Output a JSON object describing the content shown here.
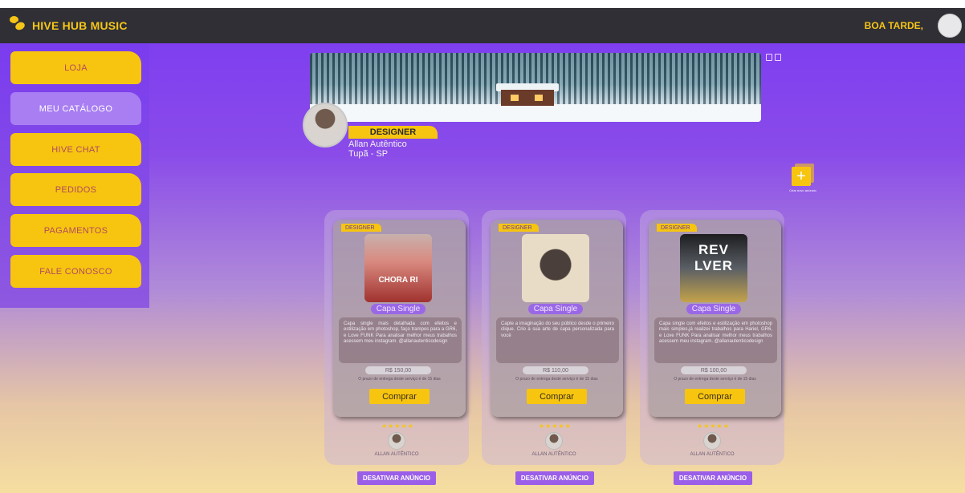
{
  "app": {
    "brand": "HIVE HUB MUSIC",
    "greeting": "BOA TARDE,"
  },
  "sidebar": {
    "items": [
      {
        "label": "LOJA",
        "active": false
      },
      {
        "label": "MEU CATÁLOGO",
        "active": true
      },
      {
        "label": "HIVE CHAT",
        "active": false
      },
      {
        "label": "PEDIDOS",
        "active": false
      },
      {
        "label": "PAGAMENTOS",
        "active": false
      },
      {
        "label": "FALE CONOSCO",
        "active": false
      }
    ]
  },
  "profile": {
    "role": "DESIGNER",
    "name": "Allan Autêntico",
    "location": "Tupã - SP"
  },
  "create": {
    "label": "Criar novo anúncio"
  },
  "cards": [
    {
      "tag": "DESIGNER",
      "cover_text": "CHORA RI",
      "service": "Capa Single",
      "description": "Capa single mais detalhada com efeitos e estilização em photoshop, faço trampos para a GR6, e Love FUNK Para analisar melhor meus trabalhos acessem meu instagram. @allanautenticodesign",
      "price": "R$ 150,00",
      "delivery": "O prazo de entrega deste serviço é de 15 dias",
      "buy_label": "Comprar",
      "stars": "★★★★★",
      "owner": "ALLAN AUTÊNTICO",
      "deactivate_label": "DESATIVAR ANÚNCIO"
    },
    {
      "tag": "DESIGNER",
      "cover_text": "",
      "service": "Capa Single",
      "description": "Capte a imaginação do seu público desde o primeiro clique. Crio a sua arte de capa personalizada para você",
      "price": "R$ 110,00",
      "delivery": "O prazo de entrega deste serviço é de 15 dias",
      "buy_label": "Comprar",
      "stars": "★★★★★",
      "owner": "ALLAN AUTÊNTICO",
      "deactivate_label": "DESATIVAR ANÚNCIO"
    },
    {
      "tag": "DESIGNER",
      "cover_text": "REV LVER",
      "service": "Capa Single",
      "description": "Capa single com efeitos e estilização em photoshop mais simples,já realizei trabalhos para Hariel, GR6, e Love FUNK Para analisar melhor meus trabalhos acessem meu instagram. @allanautenticodesign",
      "price": "R$ 100,00",
      "delivery": "O prazo de entrega deste serviço é de 15 dias",
      "buy_label": "Comprar",
      "stars": "★★★★★",
      "owner": "ALLAN AUTÊNTICO",
      "deactivate_label": "DESATIVAR ANÚNCIO"
    }
  ],
  "colors": {
    "accent": "#f7c50f",
    "purple": "#7b3bf2",
    "topbar": "#2f2f35"
  }
}
